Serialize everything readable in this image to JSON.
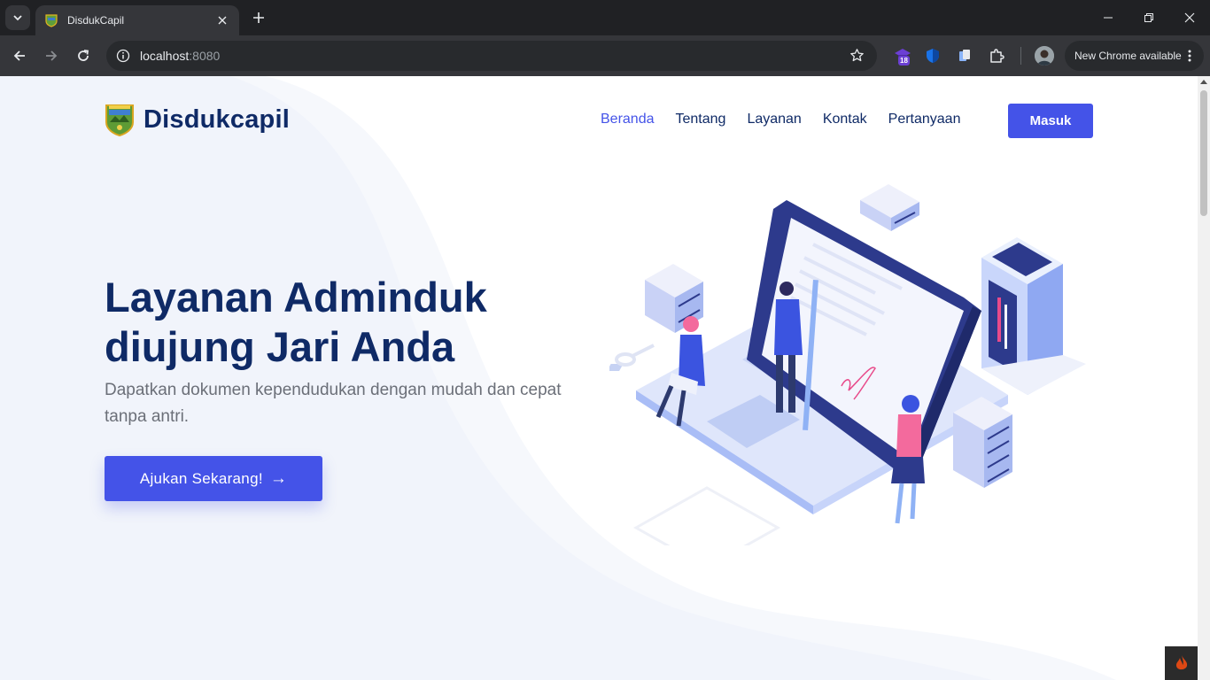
{
  "browser": {
    "tab_title": "DisdukCapil",
    "url_host": "localhost",
    "url_port": ":8080",
    "extension_badge": "18",
    "update_label": "New Chrome available"
  },
  "page": {
    "brand_name": "Disdukcapil",
    "nav": [
      "Beranda",
      "Tentang",
      "Layanan",
      "Kontak",
      "Pertanyaan"
    ],
    "active_nav": "Beranda",
    "login_label": "Masuk",
    "hero_title_line1": "Layanan Adminduk",
    "hero_title_line2": "diujung Jari Anda",
    "hero_subtitle": "Dapatkan dokumen kependudukan dengan mudah dan cepat tanpa antri.",
    "cta_label": "Ajukan Sekarang!",
    "cta_arrow": "→"
  },
  "colors": {
    "primary": "#4453e8",
    "navy": "#0f2a66",
    "chrome_dark": "#202124",
    "chrome_toolbar": "#35363a"
  }
}
